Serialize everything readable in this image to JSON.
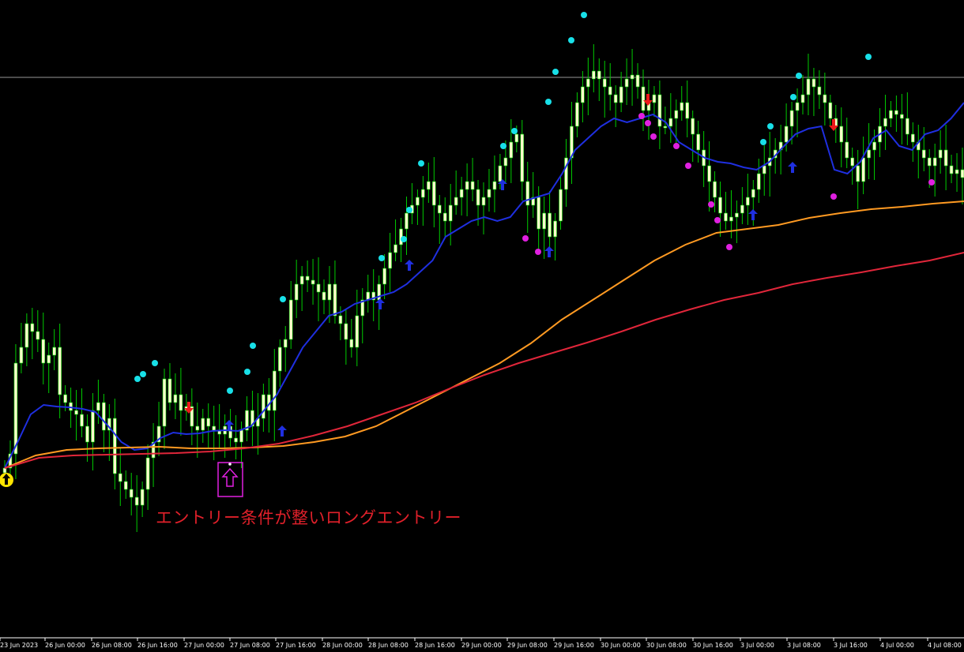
{
  "chart_data": {
    "type": "candlestick",
    "background": "#000000",
    "up_color": "#ffffcc",
    "wick_color": "#00cc00",
    "grid": false,
    "legend": "none",
    "x_ticks": [
      "23 Jun 2023",
      "26 Jun 00:00",
      "26 Jun 08:00",
      "26 Jun 16:00",
      "27 Jun 00:00",
      "27 Jun 08:00",
      "27 Jun 16:00",
      "28 Jun 00:00",
      "28 Jun 08:00",
      "28 Jun 16:00",
      "29 Jun 00:00",
      "29 Jun 08:00",
      "29 Jun 16:00",
      "30 Jun 00:00",
      "30 Jun 08:00",
      "30 Jun 16:00",
      "3 Jul 00:00",
      "3 Jul 08:00",
      "3 Jul 16:00",
      "4 Jul 00:00",
      "4 Jul 08:00"
    ],
    "closes": [
      593,
      575,
      460,
      440,
      410,
      420,
      430,
      460,
      450,
      440,
      500,
      510,
      520,
      525,
      540,
      560,
      520,
      510,
      545,
      530,
      600,
      610,
      620,
      630,
      640,
      620,
      580,
      560,
      540,
      480,
      510,
      500,
      520,
      515,
      540,
      545,
      530,
      540,
      545,
      550,
      540,
      555,
      560,
      545,
      520,
      540,
      530,
      500,
      520,
      470,
      440,
      430,
      380,
      360,
      350,
      355,
      360,
      370,
      380,
      360,
      400,
      410,
      430,
      440,
      400,
      380,
      370,
      380,
      360,
      340,
      320,
      310,
      290,
      270,
      260,
      250,
      240,
      230,
      260,
      270,
      280,
      260,
      250,
      240,
      230,
      240,
      260,
      250,
      240,
      230,
      210,
      200,
      180,
      170,
      230,
      260,
      250,
      290,
      270,
      300,
      280,
      240,
      200,
      160,
      130,
      110,
      100,
      90,
      100,
      110,
      120,
      130,
      110,
      100,
      95,
      110,
      140,
      130,
      120,
      160,
      160,
      150,
      140,
      130,
      150,
      170,
      190,
      210,
      230,
      250,
      270,
      280,
      275,
      270,
      260,
      250,
      240,
      220,
      210,
      200,
      190,
      180,
      160,
      140,
      130,
      120,
      100,
      110,
      120,
      130,
      150,
      160,
      180,
      200,
      210,
      230,
      200,
      190,
      180,
      160,
      150,
      140,
      145,
      150,
      170,
      180,
      190,
      200,
      210,
      200,
      190,
      210,
      220,
      215,
      225
    ],
    "series": [
      {
        "values": [
          593,
          560,
          525,
          513,
          515,
          516,
          518,
          522,
          540,
          560,
          570,
          568,
          555,
          548,
          550,
          549,
          546,
          545,
          546,
          540,
          520,
          500,
          470,
          440,
          420,
          400,
          395,
          385,
          380,
          375,
          370,
          360,
          345,
          330,
          300,
          290,
          280,
          275,
          280,
          275,
          255,
          250,
          245,
          220,
          190,
          175,
          160,
          150,
          155,
          150,
          145,
          155,
          180,
          190,
          200,
          205,
          207,
          212,
          215,
          205,
          187,
          170,
          163,
          160,
          215,
          220,
          205,
          175,
          165,
          185,
          190,
          170,
          165,
          150,
          130
        ]
      },
      {
        "values": [
          593,
          577,
          570,
          568,
          567,
          566,
          568,
          568,
          567,
          565,
          560,
          553,
          540,
          520,
          500,
          480,
          460,
          435,
          405,
          380,
          355,
          330,
          310,
          295,
          290,
          285,
          276,
          270,
          265,
          262,
          258,
          255
        ]
      },
      {
        "values": [
          593,
          580,
          577,
          576,
          575,
          574,
          572,
          568,
          562,
          552,
          540,
          525,
          510,
          492,
          475,
          460,
          447,
          434,
          420,
          405,
          392,
          380,
          371,
          360,
          352,
          345,
          337,
          330,
          320
        ]
      }
    ],
    "horizontal_line": 98,
    "annotation": "エントリー条件が整いロングエントリー"
  }
}
